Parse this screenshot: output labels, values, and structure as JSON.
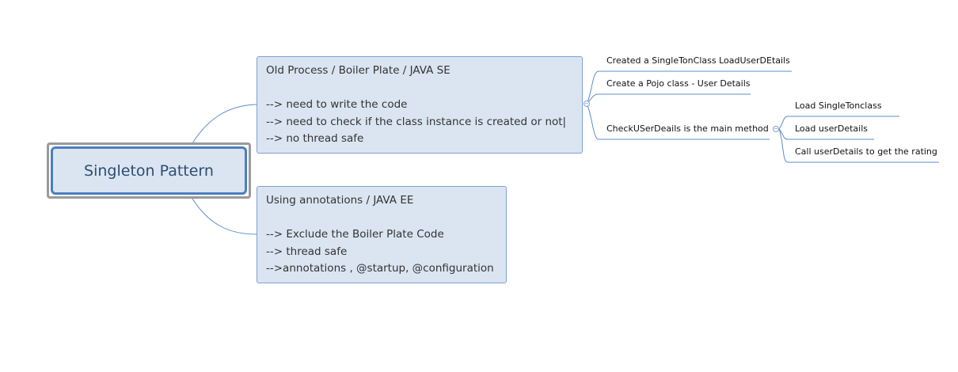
{
  "central_topic": {
    "label": "Singleton Pattern"
  },
  "topics": [
    {
      "lines": [
        "Old Process / Boiler Plate / JAVA SE",
        "",
        "--> need to write the code",
        "--> need to check if the class instance is created or not|",
        "--> no thread safe"
      ],
      "subtopics": [
        {
          "label": "Created a SingleTonClass LoadUserDEtails"
        },
        {
          "label": "Create a Pojo class - User Details"
        },
        {
          "label": "CheckUSerDeails is the main method",
          "subtopics": [
            {
              "label": "Load SingleTonclass"
            },
            {
              "label": "Load userDetails"
            },
            {
              "label": "Call userDetails to get the rating"
            }
          ]
        }
      ]
    },
    {
      "lines": [
        "Using annotations / JAVA EE",
        "",
        "--> Exclude the Boiler Plate Code",
        "-->  thread safe",
        "-->annotations , @startup, @configuration"
      ]
    }
  ],
  "colors": {
    "topic_fill": "#dbe5f1",
    "topic_border": "#7ea1cf",
    "central_border": "#4a7fc1",
    "central_text": "#2e4d73",
    "connector": "#5b82b8"
  },
  "icons": {
    "collapse_toggle": "minus-circle-icon"
  }
}
